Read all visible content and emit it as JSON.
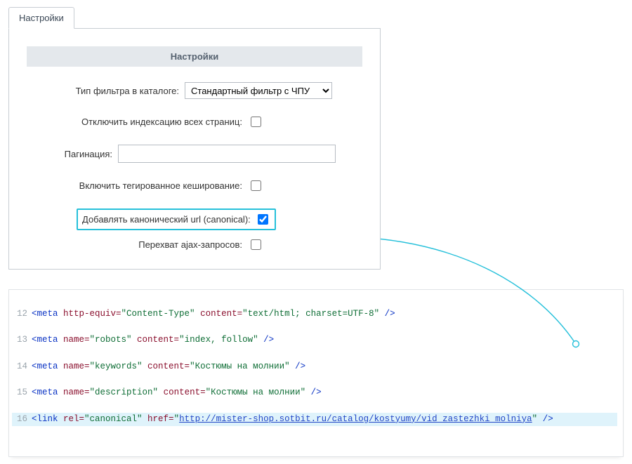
{
  "tab": {
    "label": "Настройки"
  },
  "section": {
    "header": "Настройки"
  },
  "form": {
    "filter_label": "Тип фильтра в каталоге:",
    "filter_value": "Стандартный фильтр с ЧПУ",
    "disable_index_label": "Отключить индексацию всех страниц:",
    "pagination_label": "Пагинация:",
    "pagination_value": "",
    "tagged_cache_label": "Включить тегированное кеширование:",
    "canonical_label": "Добавлять канонический url (canonical):",
    "ajax_label": "Перехват ajax-запросов:"
  },
  "code": {
    "l12": {
      "ln": "12",
      "tag_open": "<meta",
      "attr1": " http-equiv=",
      "val1": "\"Content-Type\"",
      "attr2": " content=",
      "val2": "\"text/html; charset=UTF-8\"",
      "close": " />"
    },
    "l13": {
      "ln": "13",
      "tag_open": "<meta",
      "attr1": " name=",
      "val1": "\"robots\"",
      "attr2": " content=",
      "val2": "\"index, follow\"",
      "close": " />"
    },
    "l14": {
      "ln": "14",
      "tag_open": "<meta",
      "attr1": " name=",
      "val1": "\"keywords\"",
      "attr2": " content=",
      "val2_q": "\"",
      "val2_txt": "Костюмы на молнии",
      "close": " />"
    },
    "l15": {
      "ln": "15",
      "tag_open": "<meta",
      "attr1": " name=",
      "val1": "\"description\"",
      "attr2": " content=",
      "val2_q": "\"",
      "val2_txt": "Костюмы на молнии",
      "close": " />"
    },
    "l16": {
      "ln": "16",
      "tag_open": "<link",
      "attr1": " rel=",
      "val1": "\"canonical\"",
      "attr2": " href=",
      "q": "\"",
      "url": "http://mister-shop.sotbit.ru/catalog/kostyumy/vid_zastezhki_molniya",
      "close": " />"
    }
  }
}
